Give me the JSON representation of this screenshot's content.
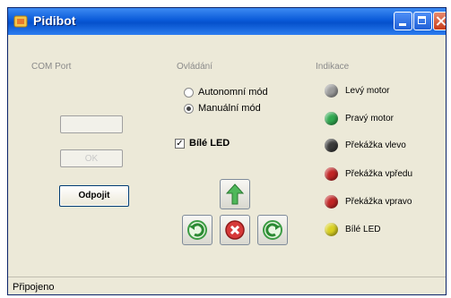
{
  "window": {
    "title": "Pidibot"
  },
  "com_port": {
    "label": "COM Port",
    "connect_label": "OK",
    "disconnect_label": "Odpojit"
  },
  "control": {
    "label": "Ovládání",
    "mode_auto": "Autonomní mód",
    "mode_manual": "Manuální mód",
    "selected_mode": "manual",
    "led_label": "Bílé LED",
    "led_checked": true
  },
  "indication": {
    "label": "Indikace",
    "items": [
      {
        "label": "Levý motor",
        "color": "#9a9a9a"
      },
      {
        "label": "Pravý motor",
        "color": "#2fa84f"
      },
      {
        "label": "Překážka vlevo",
        "color": "#3a3a3a"
      },
      {
        "label": "Překážka vpředu",
        "color": "#c02424"
      },
      {
        "label": "Překážka vpravo",
        "color": "#c02424"
      },
      {
        "label": "Bílé LED",
        "color": "#d9d020"
      }
    ]
  },
  "status": {
    "text": "Připojeno"
  }
}
